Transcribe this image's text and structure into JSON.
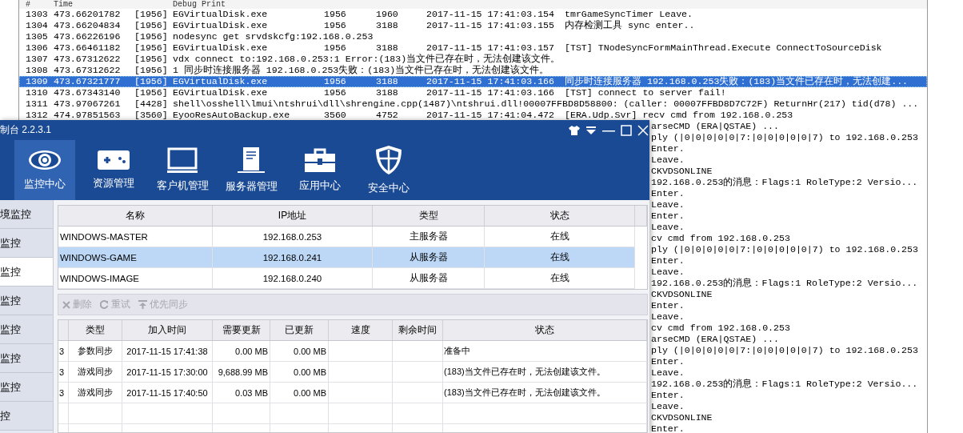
{
  "log": {
    "header": {
      "num": "#",
      "time": "Time",
      "text": "Debug Print"
    },
    "rows": [
      {
        "kind": "process",
        "num": "1303",
        "time": "473.66201782",
        "prefix": "[1956]",
        "process": "EGVirtualDisk.exe",
        "field_1": "1956",
        "field_2": "1960",
        "timestamp": "2017-11-15 17:41:03.154",
        "message": "tmrGameSyncTimer Leave.",
        "selected": false
      },
      {
        "kind": "process",
        "num": "1304",
        "time": "473.66204834",
        "prefix": "[1956]",
        "process": "EGVirtualDisk.exe",
        "field_1": "1956",
        "field_2": "3188",
        "timestamp": "2017-11-15 17:41:03.155",
        "message": "内存检测工具 sync enter..",
        "selected": false
      },
      {
        "kind": "text",
        "num": "1305",
        "time": "473.66226196",
        "prefix": "[1956]",
        "message": "nodesync get srvdskcfg:192.168.0.253",
        "selected": false
      },
      {
        "kind": "process",
        "num": "1306",
        "time": "473.66461182",
        "prefix": "[1956]",
        "process": "EGVirtualDisk.exe",
        "field_1": "1956",
        "field_2": "3188",
        "timestamp": "2017-11-15 17:41:03.157",
        "message": "[TST] TNodeSyncFormMainThread.Execute ConnectToSourceDisk",
        "selected": false
      },
      {
        "kind": "text",
        "num": "1307",
        "time": "473.67312622",
        "prefix": "[1956]",
        "message": "vdx connect to:192.168.0.253:1 Error:(183)当文件已存在时，无法创建该文件。",
        "selected": false
      },
      {
        "kind": "text",
        "num": "1308",
        "time": "473.67312622",
        "prefix": "[1956]",
        "message": "1 同步时连接服务器 192.168.0.253失败：(183)当文件已存在时，无法创建该文件。",
        "selected": false
      },
      {
        "kind": "process",
        "num": "1309",
        "time": "473.67321777",
        "prefix": "[1956]",
        "process": "EGVirtualDisk.exe",
        "field_1": "1956",
        "field_2": "3188",
        "timestamp": "2017-11-15 17:41:03.166",
        "message": "同步时连接服务器 192.168.0.253失败：(183)当文件已存在时，无法创建...",
        "selected": true
      },
      {
        "kind": "process",
        "num": "1310",
        "time": "473.67343140",
        "prefix": "[1956]",
        "process": "EGVirtualDisk.exe",
        "field_1": "1956",
        "field_2": "3188",
        "timestamp": "2017-11-15 17:41:03.166",
        "message": "[TST] connect to server fail!",
        "selected": false
      },
      {
        "kind": "text",
        "num": "1311",
        "time": "473.97067261",
        "prefix": "[4428]",
        "message": "shell\\osshell\\lmui\\ntshrui\\dll\\shrengine.cpp(1487)\\ntshrui.dll!00007FFBD8D58800: (caller: 00007FFBD8D7C72F) ReturnHr(217) tid(d78) ...",
        "selected": false
      },
      {
        "kind": "process",
        "num": "1312",
        "time": "474.97851563",
        "prefix": "[3560]",
        "process": "EyooResAutoBackup.exe",
        "field_1": "3560",
        "field_2": "4752",
        "timestamp": "2017-11-15 17:41:04.472",
        "message": "[ERA.Udp.Svr] recv cmd from 192.168.0.253",
        "selected": false
      }
    ],
    "partial_rows": [
      "arseCMD (ERA|QSTAE) ...",
      "ply (|0|0|0|0|0|7:|0|0|0|0|0|7) to 192.168.0.253",
      "Enter.",
      "Leave.",
      "CKVDSONLINE",
      "192.168.0.253的消息：Flags:1 RoleType:2 Versio...",
      "Enter.",
      "Leave.",
      "Enter.",
      "Leave.",
      "cv cmd from 192.168.0.253",
      "ply (|0|0|0|0|0|7:|0|0|0|0|0|7) to 192.168.0.253",
      "Enter.",
      "Leave.",
      "192.168.0.253的消息：Flags:1 RoleType:2 Versio...",
      "CKVDSONLINE",
      "Enter.",
      "Leave.",
      "cv cmd from 192.168.0.253",
      "arseCMD (ERA|QSTAE) ...",
      "ply (|0|0|0|0|0|7:|0|0|0|0|0|7) to 192.168.0.253",
      "Enter.",
      "Leave.",
      "192.168.0.253的消息：Flags:1 RoleType:2 Versio...",
      "Enter.",
      "Leave.",
      "CKVDSONLINE",
      "Enter."
    ]
  },
  "app": {
    "title": "制台 2.2.3.1",
    "nav": [
      {
        "label": "监控中心",
        "selected": true
      },
      {
        "label": "资源管理",
        "selected": false
      },
      {
        "label": "客户机管理",
        "selected": false
      },
      {
        "label": "服务器管理",
        "selected": false
      },
      {
        "label": "应用中心",
        "selected": false
      },
      {
        "label": "安全中心",
        "selected": false
      }
    ],
    "sidebar": [
      {
        "label": "境监控",
        "selected": false
      },
      {
        "label": "监控",
        "selected": false
      },
      {
        "label": "监控",
        "selected": true
      },
      {
        "label": "监控",
        "selected": false
      },
      {
        "label": "监控",
        "selected": false
      },
      {
        "label": "监控",
        "selected": false
      },
      {
        "label": "监控",
        "selected": false
      },
      {
        "label": "控",
        "selected": false
      }
    ],
    "servers": {
      "columns": [
        "名称",
        "IP地址",
        "类型",
        "状态"
      ],
      "rows": [
        {
          "cells": [
            "WINDOWS-MASTER",
            "192.168.0.253",
            "主服务器",
            "在线"
          ],
          "selected": false
        },
        {
          "cells": [
            "WINDOWS-GAME",
            "192.168.0.241",
            "从服务器",
            "在线"
          ],
          "selected": true
        },
        {
          "cells": [
            "WINDOWS-IMAGE",
            "192.168.0.240",
            "从服务器",
            "在线"
          ],
          "selected": false
        }
      ]
    },
    "actions": [
      {
        "label": "删除",
        "disabled": true
      },
      {
        "label": "重试",
        "disabled": true
      },
      {
        "label": "优先同步",
        "disabled": true
      }
    ],
    "tasks": {
      "columns": [
        "类型",
        "加入时间",
        "需要更新",
        "已更新",
        "速度",
        "剩余时间",
        "状态"
      ],
      "rows": [
        {
          "column_1": "3",
          "cells": [
            "参数同步",
            "2017-11-15 17:41:38",
            "0.00 MB",
            "0.00 MB",
            null,
            null,
            "准备中"
          ]
        },
        {
          "column_1": "3",
          "cells": [
            "游戏同步",
            "2017-11-15 17:30:00",
            "9,688.99 MB",
            "0.00 MB",
            null,
            null,
            "(183)当文件已存在时，无法创建该文件。"
          ]
        },
        {
          "column_1": "3",
          "cells": [
            "游戏同步",
            "2017-11-15 17:40:50",
            "0.03 MB",
            "0.00 MB",
            null,
            null,
            "(183)当文件已存在时，无法创建该文件。"
          ]
        }
      ]
    }
  }
}
